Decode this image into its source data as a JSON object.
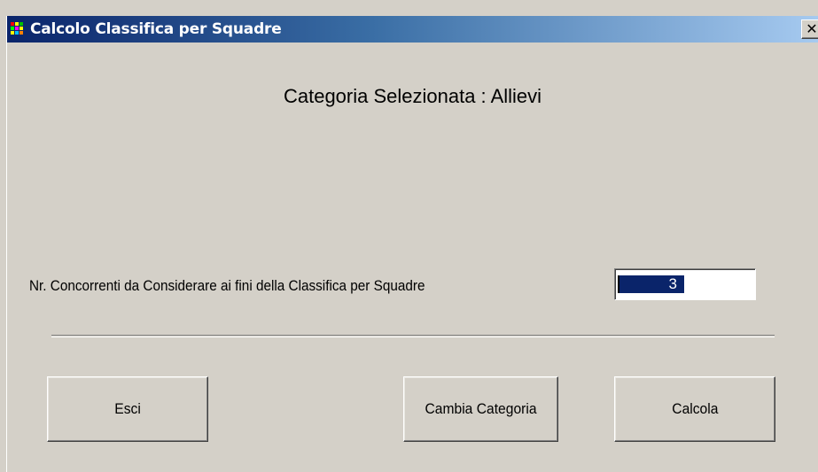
{
  "window": {
    "title": "Calcolo Classifica per Squadre",
    "close_label": "✕",
    "app_icon": "team-ranking-icon"
  },
  "main": {
    "heading": "Categoria Selezionata : Allievi",
    "field_label": "Nr. Concorrenti da Considerare ai fini della Classifica per Squadre",
    "field_value": "3"
  },
  "buttons": {
    "exit": "Esci",
    "change_category": "Cambia Categoria",
    "calculate": "Calcola"
  },
  "colors": {
    "titlebar_start": "#0a246a",
    "titlebar_end": "#a6caf0",
    "face": "#d4d0c8",
    "selection": "#0a246a"
  }
}
